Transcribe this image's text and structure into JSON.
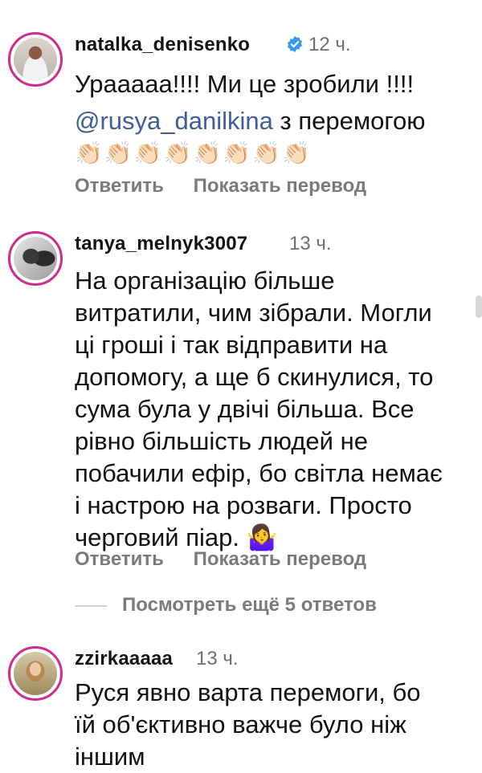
{
  "comments": [
    {
      "username": "natalka_denisenko",
      "time": "12 ч.",
      "line1": "Ураааaa!!!! Ми це зробили !!!!",
      "mention": "@rusya_danilkina",
      "line2_rest": " з перемогою",
      "emoji": "👏🏻👏🏻👏🏻👏🏻👏🏻👏🏻👏🏻👏🏻",
      "reply": "Ответить",
      "translate": "Показать перевод"
    },
    {
      "username": "tanya_melnyk3007",
      "time": "13 ч.",
      "lines": [
        "На організацію більше",
        "витратили, чим зібрали. Могли",
        "ці гроші і так відправити на",
        "допомогу, а ще б скинулися, то",
        "сума була у двічі більша. Все",
        "рівно більшість людей не",
        "побачили ефір, бо світла немає",
        "і настрою на розваги. Просто",
        "черговий піар. 🤷‍♀️"
      ],
      "reply": "Ответить",
      "translate": "Показать перевод",
      "more_replies": "Посмотреть ещё 5 ответов"
    },
    {
      "username": "zzirkaaaaa",
      "time": "13 ч.",
      "lines": [
        "Руся явно варта перемоги, бо",
        "їй об'єктивно важче було ніж",
        "іншим"
      ]
    }
  ],
  "colors": {
    "avatar_ring": "#cf2c8b",
    "mention": "#3f5d9c",
    "muted": "#7a7a7a",
    "verified": "#3897f0"
  }
}
